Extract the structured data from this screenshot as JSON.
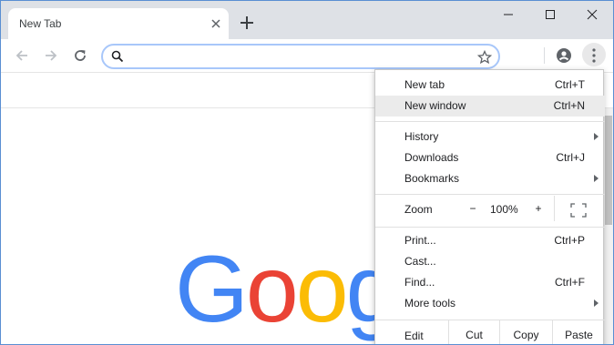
{
  "tab": {
    "title": "New Tab"
  },
  "window_controls": {
    "minimize": "minimize-icon",
    "maximize": "maximize-icon",
    "close": "close-icon"
  },
  "toolbar": {
    "omnibox_placeholder": "",
    "icons": [
      "back-icon",
      "forward-icon",
      "reload-icon",
      "search-icon",
      "star-icon",
      "profile-icon",
      "kebab-menu-icon"
    ]
  },
  "page": {
    "logo_letters": [
      {
        "ch": "G",
        "color": "#4285F4"
      },
      {
        "ch": "o",
        "color": "#EA4335"
      },
      {
        "ch": "o",
        "color": "#FBBC05"
      },
      {
        "ch": "g",
        "color": "#4285F4"
      }
    ]
  },
  "menu": {
    "items_top": [
      {
        "label": "New tab",
        "shortcut": "Ctrl+T"
      },
      {
        "label": "New window",
        "shortcut": "Ctrl+N",
        "highlighted": true
      }
    ],
    "items_history": [
      {
        "label": "History",
        "shortcut": "",
        "submenu": true
      },
      {
        "label": "Downloads",
        "shortcut": "Ctrl+J"
      },
      {
        "label": "Bookmarks",
        "shortcut": "",
        "submenu": true
      }
    ],
    "zoom": {
      "label": "Zoom",
      "minus": "−",
      "value": "100%",
      "plus": "+"
    },
    "items_tools": [
      {
        "label": "Print...",
        "shortcut": "Ctrl+P"
      },
      {
        "label": "Cast...",
        "shortcut": ""
      },
      {
        "label": "Find...",
        "shortcut": "Ctrl+F"
      },
      {
        "label": "More tools",
        "shortcut": "",
        "submenu": true
      }
    ],
    "edit": {
      "label": "Edit",
      "cut": "Cut",
      "copy": "Copy",
      "paste": "Paste"
    }
  },
  "colors": {
    "tabstrip": "#dee1e6",
    "menu_hover": "#ebebeb",
    "omnibox_border": "#a8c7fa"
  }
}
